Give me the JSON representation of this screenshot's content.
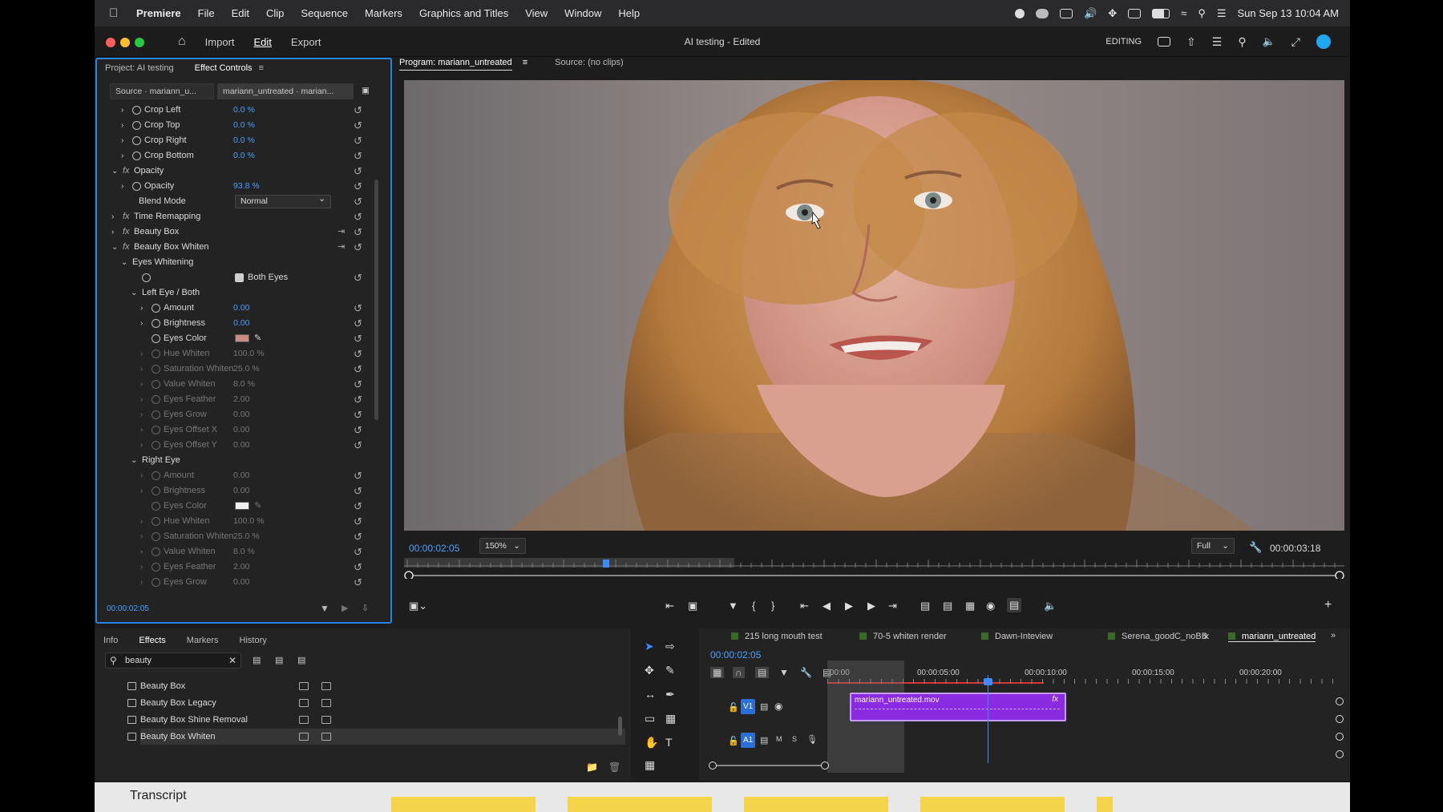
{
  "menubar": {
    "app": "Premiere",
    "items": [
      "File",
      "Edit",
      "Clip",
      "Sequence",
      "Markers",
      "Graphics and Titles",
      "View",
      "Window",
      "Help"
    ],
    "datetime": "Sun Sep 13  10:04 AM"
  },
  "titlebar": {
    "nav": {
      "import": "Import",
      "edit": "Edit",
      "export": "Export"
    },
    "document_title": "AI testing - Edited",
    "workspace": "EDITING"
  },
  "effect_controls": {
    "tabs": {
      "project": "Project: AI testing",
      "effect_controls": "Effect Controls"
    },
    "source_tab": "Source · mariann_u...",
    "clip_tab": "mariann_untreated · marian...",
    "rows": [
      {
        "label": "Crop Left",
        "value": "0.0 %"
      },
      {
        "label": "Crop Top",
        "value": "0.0 %"
      },
      {
        "label": "Crop Right",
        "value": "0.0 %"
      },
      {
        "label": "Crop Bottom",
        "value": "0.0 %"
      },
      {
        "label": "Opacity",
        "value": ""
      },
      {
        "label": "Opacity",
        "value": "93.8 %"
      },
      {
        "label": "Blend Mode",
        "value": "Normal"
      },
      {
        "label": "Time Remapping",
        "value": ""
      },
      {
        "label": "Beauty Box",
        "value": ""
      },
      {
        "label": "Beauty Box Whiten",
        "value": ""
      },
      {
        "label": "Eyes Whitening",
        "value": ""
      },
      {
        "label": "Both Eyes",
        "value": ""
      },
      {
        "label": "Left Eye / Both",
        "value": ""
      },
      {
        "label": "Amount",
        "value": "0.00"
      },
      {
        "label": "Brightness",
        "value": "0.00"
      },
      {
        "label": "Eyes Color",
        "value": ""
      },
      {
        "label": "Hue Whiten",
        "value": "100.0 %"
      },
      {
        "label": "Saturation Whiten",
        "value": "25.0 %"
      },
      {
        "label": "Value Whiten",
        "value": "8.0 %"
      },
      {
        "label": "Eyes Feather",
        "value": "2.00"
      },
      {
        "label": "Eyes Grow",
        "value": "0.00"
      },
      {
        "label": "Eyes Offset X",
        "value": "0.00"
      },
      {
        "label": "Eyes Offset Y",
        "value": "0.00"
      },
      {
        "label": "Right Eye",
        "value": ""
      },
      {
        "label": "Amount",
        "value": "0.00"
      },
      {
        "label": "Brightness",
        "value": "0.00"
      },
      {
        "label": "Eyes Color",
        "value": ""
      },
      {
        "label": "Hue Whiten",
        "value": "100.0 %"
      },
      {
        "label": "Saturation Whiten",
        "value": "25.0 %"
      },
      {
        "label": "Value Whiten",
        "value": "8.0 %"
      },
      {
        "label": "Eyes Feather",
        "value": "2.00"
      },
      {
        "label": "Eyes Grow",
        "value": "0.00"
      }
    ],
    "timecode": "00:00:02:05"
  },
  "program_monitor": {
    "tab_program": "Program: mariann_untreated",
    "tab_source": "Source: (no clips)",
    "timecode": "00:00:02:05",
    "zoom": "150%",
    "resolution": "Full",
    "duration": "00:00:03:18"
  },
  "effects_panel": {
    "tabs": {
      "info": "Info",
      "effects": "Effects",
      "markers": "Markers",
      "history": "History"
    },
    "search_value": "beauty",
    "items": [
      "Beauty Box",
      "Beauty Box Legacy",
      "Beauty Box Shine Removal",
      "Beauty Box Whiten"
    ]
  },
  "timeline": {
    "tabs": [
      "215 long mouth test",
      "70-5 whiten render",
      "Dawn-Inteview",
      "Serena_goodC_noBB",
      "mariann_untreated"
    ],
    "timecode": "00:00:02:05",
    "ruler": [
      ":00:00",
      "00:00:05:00",
      "00:00:10:00",
      "00:00:15:00",
      "00:00:20:00"
    ],
    "tracks": {
      "v1": "V1",
      "a1": "A1"
    },
    "clip_name": "mariann_untreated.mov"
  },
  "transcript": {
    "title": "Transcript"
  },
  "colors": {
    "accent": "#2a82e4",
    "timecode": "#4aa0ff",
    "clip": "#8a2be2"
  }
}
